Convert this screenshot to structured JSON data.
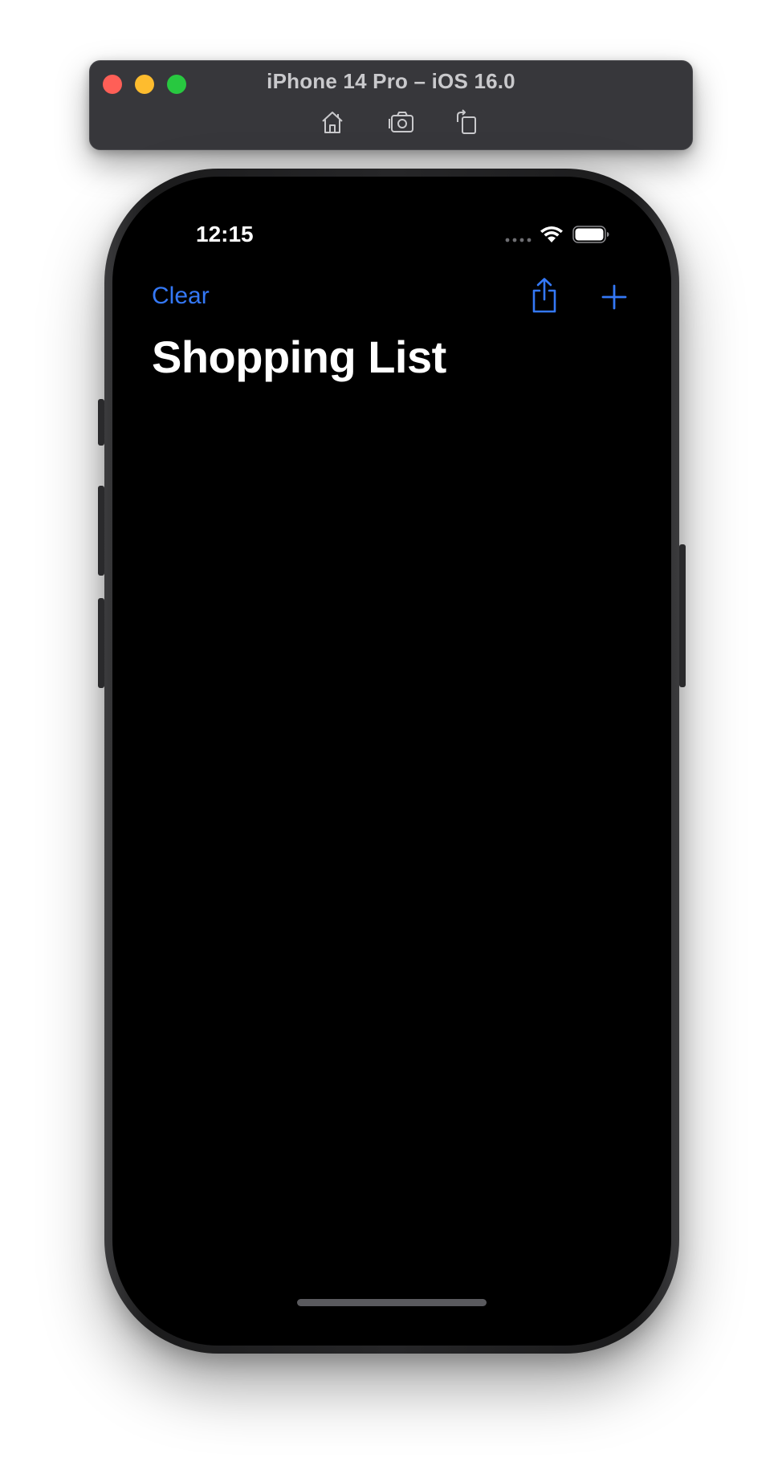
{
  "simulator": {
    "title": "iPhone 14 Pro – iOS 16.0",
    "toolbar_icons": [
      "home-icon",
      "screenshot-icon",
      "rotate-icon"
    ]
  },
  "status_bar": {
    "time": "12:15",
    "icons": [
      "cellular-signal-icon",
      "wifi-icon",
      "battery-icon"
    ]
  },
  "navigation": {
    "left_button_label": "Clear",
    "right_icons": [
      "share-icon",
      "add-icon"
    ],
    "title": "Shopping List"
  },
  "colors": {
    "accent": "#3478f6",
    "background": "#000000",
    "title": "#ffffff"
  }
}
